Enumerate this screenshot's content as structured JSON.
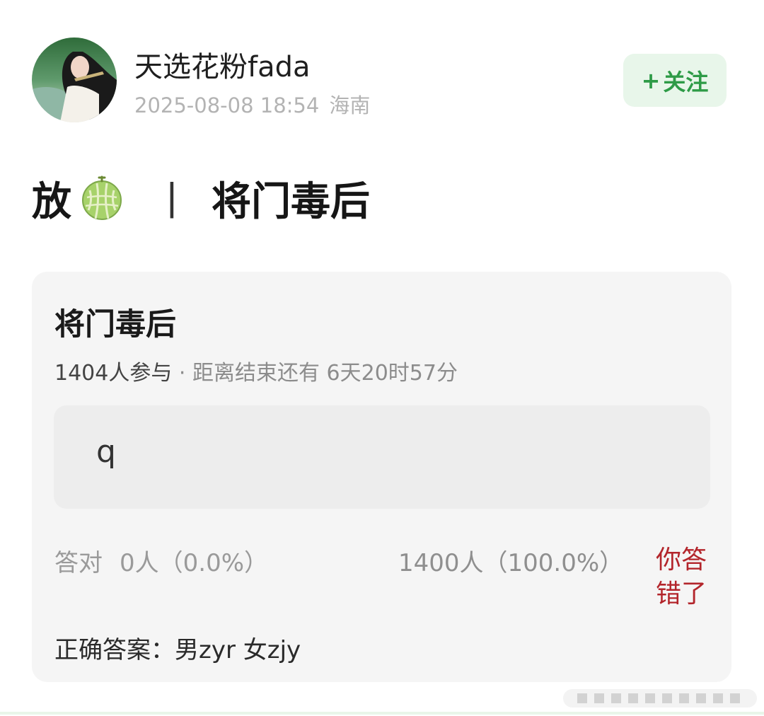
{
  "header": {
    "username": "天选花粉fada",
    "datetime": "2025-08-08 18:54",
    "location": "海南",
    "follow_label": "关注",
    "follow_plus": "+"
  },
  "post": {
    "title_prefix": "放",
    "title_separator": "丨",
    "title_suffix": "将门毒后"
  },
  "quiz": {
    "title": "将门毒后",
    "participants": "1404人参与",
    "dot": "·",
    "countdown": "距离结束还有 6天20时57分",
    "option_text": "q",
    "correct_label": "答对",
    "correct_stat": "0人（0.0%）",
    "wrong_stat": "1400人（100.0%）",
    "your_result": "你答错了",
    "answer_label": "正确答案：",
    "answer_value": "男zyr 女zjy"
  },
  "colors": {
    "accent_green": "#2e9b47",
    "follow_bg": "#e8f6ea",
    "wrong_red": "#b3252b",
    "card_bg": "#f5f5f5"
  },
  "icons": {
    "avatar": "user-avatar",
    "melon": "melon-icon",
    "plus": "plus-icon"
  }
}
